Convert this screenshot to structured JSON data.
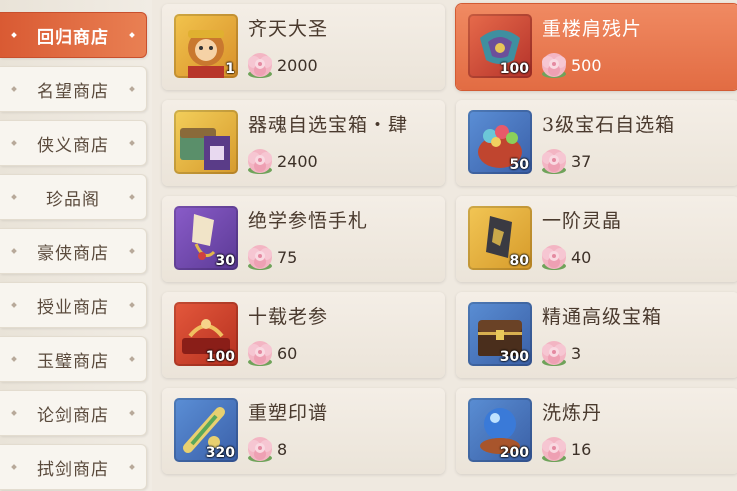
{
  "sidebar": {
    "items": [
      {
        "label": "回归商店",
        "active": true
      },
      {
        "label": "名望商店",
        "active": false
      },
      {
        "label": "侠义商店",
        "active": false
      },
      {
        "label": "珍品阁",
        "active": false
      },
      {
        "label": "豪侠商店",
        "active": false
      },
      {
        "label": "授业商店",
        "active": false
      },
      {
        "label": "玉璧商店",
        "active": false
      },
      {
        "label": "论剑商店",
        "active": false
      },
      {
        "label": "拭剑商店",
        "active": false
      }
    ]
  },
  "shop": {
    "items": [
      {
        "name": "齐天大圣",
        "qty": "1",
        "price": "2000",
        "icon": "monkey-king-icon"
      },
      {
        "name": "重楼肩残片",
        "qty": "100",
        "price": "500",
        "icon": "shoulder-fragment-icon",
        "selected": true
      },
      {
        "name": "器魂自选宝箱・肆",
        "qty": "",
        "price": "2400",
        "icon": "spirit-chest-icon"
      },
      {
        "name": "3级宝石自选箱",
        "qty": "50",
        "price": "37",
        "icon": "gem-bag-icon"
      },
      {
        "name": "绝学参悟手札",
        "qty": "30",
        "price": "75",
        "icon": "martial-notes-icon"
      },
      {
        "name": "一阶灵晶",
        "qty": "80",
        "price": "40",
        "icon": "spirit-crystal-icon"
      },
      {
        "name": "十载老参",
        "qty": "100",
        "price": "60",
        "icon": "ginseng-icon"
      },
      {
        "name": "精通高级宝箱",
        "qty": "300",
        "price": "3",
        "icon": "treasure-chest-icon"
      },
      {
        "name": "重塑印谱",
        "qty": "320",
        "price": "8",
        "icon": "seal-scroll-icon"
      },
      {
        "name": "洗炼丹",
        "qty": "200",
        "price": "16",
        "icon": "refine-pill-icon"
      }
    ],
    "currency_icon": "peony-flower-icon"
  },
  "colors": {
    "accent": "#e2683f",
    "card_bg": "#efe8de",
    "text": "#4a3a2e"
  }
}
